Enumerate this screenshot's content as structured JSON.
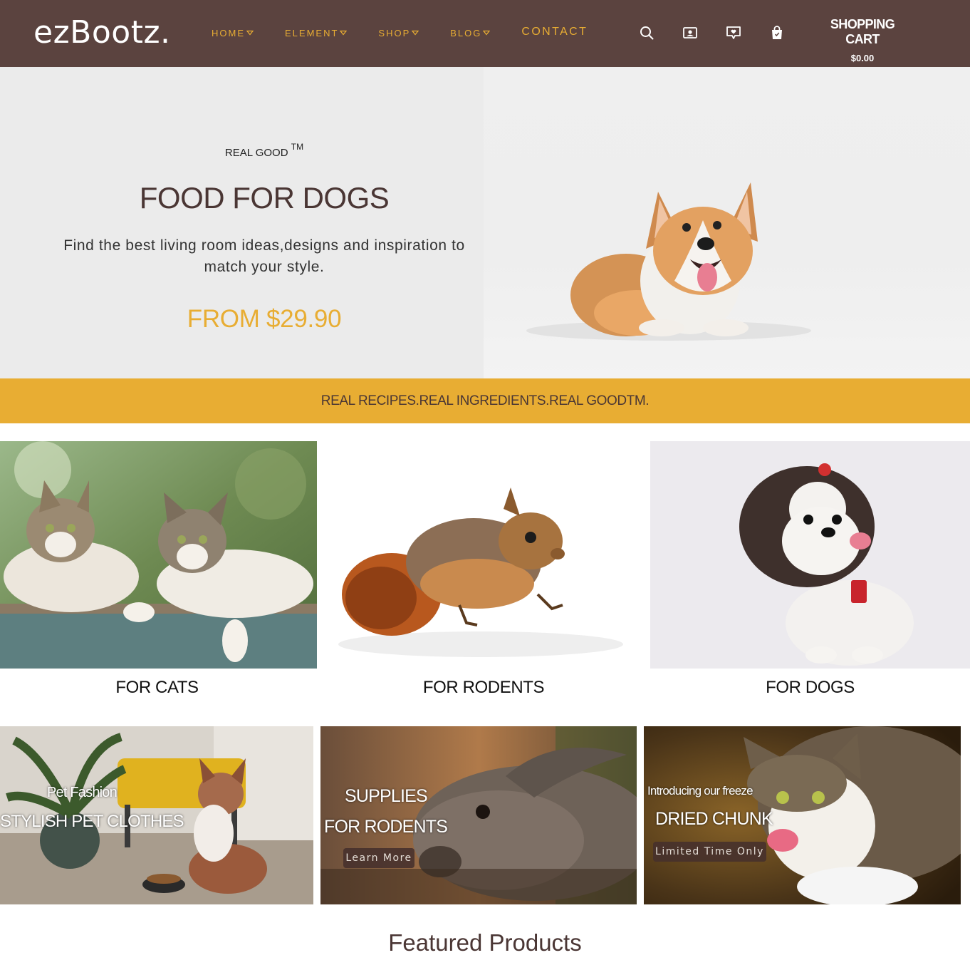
{
  "header": {
    "logo": "ezBootz.",
    "nav": [
      {
        "label": "HOME",
        "has_dropdown": true
      },
      {
        "label": "ELEMENT",
        "has_dropdown": true
      },
      {
        "label": "SHOP",
        "has_dropdown": true
      },
      {
        "label": "BLOG",
        "has_dropdown": true
      },
      {
        "label": "CONTACT",
        "has_dropdown": false
      }
    ],
    "icons": [
      "search-icon",
      "account-icon",
      "wishlist-icon",
      "shopping-bag-icon"
    ],
    "cart_title": "SHOPPING CART",
    "cart_total": "$0.00"
  },
  "hero": {
    "eyebrow": "REAL GOOD",
    "eyebrow_mark": "TM",
    "title": "FOOD FOR DOGS",
    "description": "Find the best living room ideas,designs and inspiration to match your style.",
    "price": "FROM $29.90"
  },
  "banner": {
    "text": "REAL RECIPES.REAL INGREDIENTS.REAL GOODTM."
  },
  "categories": [
    {
      "label": "FOR CATS"
    },
    {
      "label": "FOR RODENTS"
    },
    {
      "label": "FOR DOGS"
    }
  ],
  "promos": [
    {
      "line1": "Pet Fashion",
      "line2": "STYLISH PET CLOTHES"
    },
    {
      "line1": "SUPPLIES",
      "line2": "FOR RODENTS",
      "button": "Learn More"
    },
    {
      "line1": "Introducing our freeze",
      "line2": "DRIED CHUNK",
      "button": "Limited Time Only"
    }
  ],
  "featured_title": "Featured Products",
  "colors": {
    "header_bg": "#5b433f",
    "accent": "#e8ad33",
    "text_brown": "#4a3634",
    "hero_bg": "#ebebeb"
  }
}
